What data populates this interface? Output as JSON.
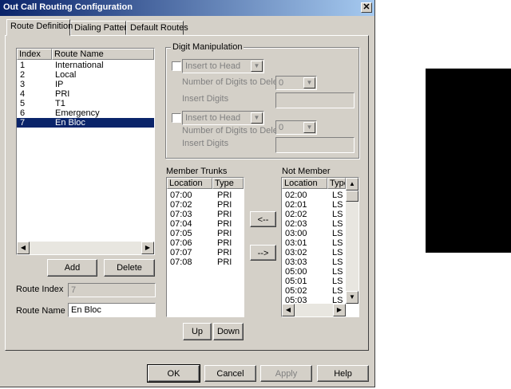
{
  "window": {
    "title": "Out Call Routing Configuration",
    "close_glyph": "✕"
  },
  "tabs": [
    {
      "label": "Route Definition",
      "active": true
    },
    {
      "label": "Dialing Pattern",
      "active": false
    },
    {
      "label": "Default Routes",
      "active": false
    }
  ],
  "route_list": {
    "columns": [
      "Index",
      "Route Name"
    ],
    "rows": [
      {
        "index": "1",
        "name": "International"
      },
      {
        "index": "2",
        "name": "Local"
      },
      {
        "index": "3",
        "name": "IP"
      },
      {
        "index": "4",
        "name": "PRI"
      },
      {
        "index": "5",
        "name": "T1"
      },
      {
        "index": "6",
        "name": "Emergency"
      },
      {
        "index": "7",
        "name": "En Bloc",
        "selected": true
      }
    ]
  },
  "route_buttons": {
    "add": "Add",
    "delete": "Delete"
  },
  "route_index": {
    "label": "Route Index",
    "value": "7"
  },
  "route_name": {
    "label": "Route Name",
    "value": "En Bloc"
  },
  "digit_manipulation": {
    "title": "Digit Manipulation",
    "block1": {
      "mode": "Insert to Head",
      "digits_label": "Number of Digits to Delete",
      "digits_value": "0",
      "insert_label": "Insert Digits",
      "insert_value": ""
    },
    "block2": {
      "mode": "Insert to Head",
      "digits_label": "Number of Digits to Delete",
      "digits_value": "0",
      "insert_label": "Insert Digits",
      "insert_value": ""
    }
  },
  "member_trunks": {
    "label": "Member Trunks",
    "columns": [
      "Location",
      "Type"
    ],
    "rows": [
      [
        "07:00",
        "PRI"
      ],
      [
        "07:02",
        "PRI"
      ],
      [
        "07:03",
        "PRI"
      ],
      [
        "07:04",
        "PRI"
      ],
      [
        "07:05",
        "PRI"
      ],
      [
        "07:06",
        "PRI"
      ],
      [
        "07:07",
        "PRI"
      ],
      [
        "07:08",
        "PRI"
      ]
    ]
  },
  "not_member": {
    "label": "Not Member",
    "columns": [
      "Location",
      "Type"
    ],
    "rows": [
      [
        "02:00",
        "LS"
      ],
      [
        "02:01",
        "LS"
      ],
      [
        "02:02",
        "LS"
      ],
      [
        "02:03",
        "LS"
      ],
      [
        "03:00",
        "LS"
      ],
      [
        "03:01",
        "LS"
      ],
      [
        "03:02",
        "LS"
      ],
      [
        "03:03",
        "LS"
      ],
      [
        "05:00",
        "LS"
      ],
      [
        "05:01",
        "LS"
      ],
      [
        "05:02",
        "LS"
      ],
      [
        "05:03",
        "LS"
      ]
    ]
  },
  "move_buttons": {
    "add": "<--",
    "remove": "-->"
  },
  "order_buttons": {
    "up": "Up",
    "down": "Down"
  },
  "footer_buttons": {
    "ok": "OK",
    "cancel": "Cancel",
    "apply": "Apply",
    "help": "Help"
  }
}
